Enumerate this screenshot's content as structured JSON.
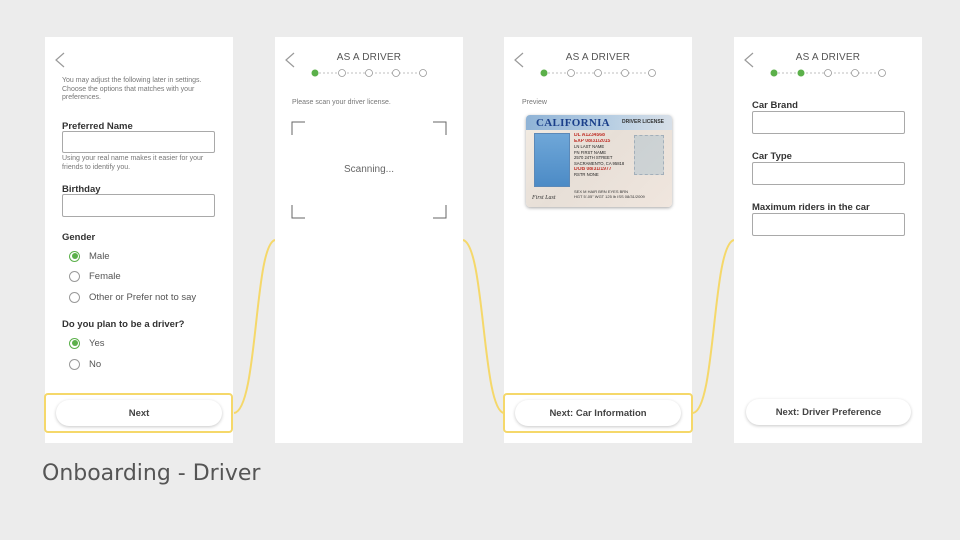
{
  "slide": {
    "caption": "Onboarding - Driver"
  },
  "colors": {
    "accent": "#5bb04a",
    "highlight": "#f5d86a",
    "background": "#ececec"
  },
  "screen1": {
    "intro": "You may adjust the following later in settings. Choose the options that matches with your preferences.",
    "preferred_name_label": "Preferred Name",
    "preferred_name_value": "",
    "name_hint": "Using your real name makes it easier for your friends to identify you.",
    "birthday_label": "Birthday",
    "birthday_value": "",
    "gender_label": "Gender",
    "gender_options": [
      {
        "label": "Male",
        "checked": true
      },
      {
        "label": "Female",
        "checked": false
      },
      {
        "label": "Other or Prefer not to say",
        "checked": false
      }
    ],
    "driver_question": "Do you plan to be a driver?",
    "driver_options": [
      {
        "label": "Yes",
        "checked": true
      },
      {
        "label": "No",
        "checked": false
      }
    ],
    "next_button": "Next"
  },
  "screen2": {
    "title": "AS A DRIVER",
    "instruction": "Please scan your driver license.",
    "scan_status": "Scanning..."
  },
  "screen3": {
    "title": "AS A DRIVER",
    "preview_label": "Preview",
    "license": {
      "state": "CALIFORNIA",
      "type": "DRIVER LICENSE",
      "dl_number": "DL A1234568",
      "exp": "EXP 08/31/2015",
      "name_last": "LN LAST NAME",
      "name_first": "FN FIRST NAME",
      "address": "2570 24TH STREET",
      "city": "SACRAMENTO, CA 95818",
      "dob": "DOB 08/31/1977",
      "rstr": "RSTR NONE",
      "sex": "SEX M",
      "hair": "HAIR BRN",
      "eyes": "EYES BRN",
      "height": "HGT 5'-05\"",
      "weight": "WGT 125 lb",
      "iss": "ISS 08/31/2009",
      "signature": "First Last"
    },
    "next_button": "Next: Car Information"
  },
  "screen4": {
    "title": "AS A DRIVER",
    "car_brand_label": "Car Brand",
    "car_brand_value": "",
    "car_type_label": "Car Type",
    "car_type_value": "",
    "max_riders_label": "Maximum riders in the car",
    "max_riders_value": "",
    "next_button": "Next: Driver Preference"
  },
  "steppers": {
    "screen2_completed": 1,
    "screen3_completed": 1,
    "screen4_completed": 2,
    "total": 5
  }
}
